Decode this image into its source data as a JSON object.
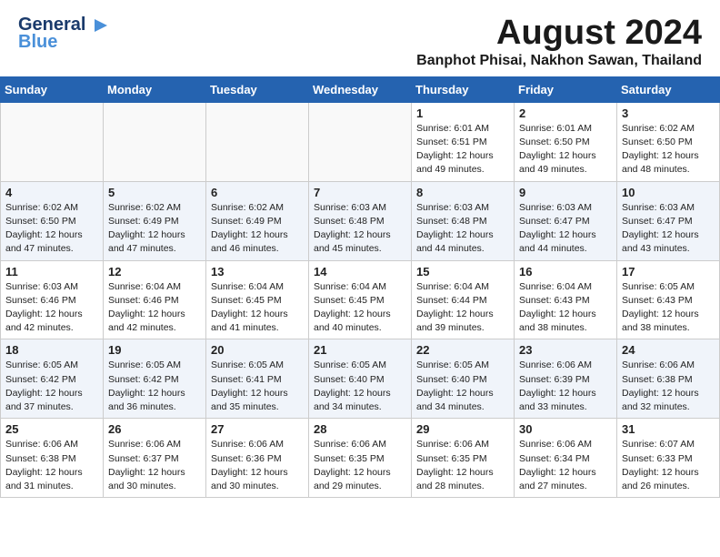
{
  "header": {
    "logo_line1": "General",
    "logo_line2": "Blue",
    "month_title": "August 2024",
    "location": "Banphot Phisai, Nakhon Sawan, Thailand"
  },
  "weekdays": [
    "Sunday",
    "Monday",
    "Tuesday",
    "Wednesday",
    "Thursday",
    "Friday",
    "Saturday"
  ],
  "weeks": [
    [
      {
        "day": "",
        "info": ""
      },
      {
        "day": "",
        "info": ""
      },
      {
        "day": "",
        "info": ""
      },
      {
        "day": "",
        "info": ""
      },
      {
        "day": "1",
        "info": "Sunrise: 6:01 AM\nSunset: 6:51 PM\nDaylight: 12 hours\nand 49 minutes."
      },
      {
        "day": "2",
        "info": "Sunrise: 6:01 AM\nSunset: 6:50 PM\nDaylight: 12 hours\nand 49 minutes."
      },
      {
        "day": "3",
        "info": "Sunrise: 6:02 AM\nSunset: 6:50 PM\nDaylight: 12 hours\nand 48 minutes."
      }
    ],
    [
      {
        "day": "4",
        "info": "Sunrise: 6:02 AM\nSunset: 6:50 PM\nDaylight: 12 hours\nand 47 minutes."
      },
      {
        "day": "5",
        "info": "Sunrise: 6:02 AM\nSunset: 6:49 PM\nDaylight: 12 hours\nand 47 minutes."
      },
      {
        "day": "6",
        "info": "Sunrise: 6:02 AM\nSunset: 6:49 PM\nDaylight: 12 hours\nand 46 minutes."
      },
      {
        "day": "7",
        "info": "Sunrise: 6:03 AM\nSunset: 6:48 PM\nDaylight: 12 hours\nand 45 minutes."
      },
      {
        "day": "8",
        "info": "Sunrise: 6:03 AM\nSunset: 6:48 PM\nDaylight: 12 hours\nand 44 minutes."
      },
      {
        "day": "9",
        "info": "Sunrise: 6:03 AM\nSunset: 6:47 PM\nDaylight: 12 hours\nand 44 minutes."
      },
      {
        "day": "10",
        "info": "Sunrise: 6:03 AM\nSunset: 6:47 PM\nDaylight: 12 hours\nand 43 minutes."
      }
    ],
    [
      {
        "day": "11",
        "info": "Sunrise: 6:03 AM\nSunset: 6:46 PM\nDaylight: 12 hours\nand 42 minutes."
      },
      {
        "day": "12",
        "info": "Sunrise: 6:04 AM\nSunset: 6:46 PM\nDaylight: 12 hours\nand 42 minutes."
      },
      {
        "day": "13",
        "info": "Sunrise: 6:04 AM\nSunset: 6:45 PM\nDaylight: 12 hours\nand 41 minutes."
      },
      {
        "day": "14",
        "info": "Sunrise: 6:04 AM\nSunset: 6:45 PM\nDaylight: 12 hours\nand 40 minutes."
      },
      {
        "day": "15",
        "info": "Sunrise: 6:04 AM\nSunset: 6:44 PM\nDaylight: 12 hours\nand 39 minutes."
      },
      {
        "day": "16",
        "info": "Sunrise: 6:04 AM\nSunset: 6:43 PM\nDaylight: 12 hours\nand 38 minutes."
      },
      {
        "day": "17",
        "info": "Sunrise: 6:05 AM\nSunset: 6:43 PM\nDaylight: 12 hours\nand 38 minutes."
      }
    ],
    [
      {
        "day": "18",
        "info": "Sunrise: 6:05 AM\nSunset: 6:42 PM\nDaylight: 12 hours\nand 37 minutes."
      },
      {
        "day": "19",
        "info": "Sunrise: 6:05 AM\nSunset: 6:42 PM\nDaylight: 12 hours\nand 36 minutes."
      },
      {
        "day": "20",
        "info": "Sunrise: 6:05 AM\nSunset: 6:41 PM\nDaylight: 12 hours\nand 35 minutes."
      },
      {
        "day": "21",
        "info": "Sunrise: 6:05 AM\nSunset: 6:40 PM\nDaylight: 12 hours\nand 34 minutes."
      },
      {
        "day": "22",
        "info": "Sunrise: 6:05 AM\nSunset: 6:40 PM\nDaylight: 12 hours\nand 34 minutes."
      },
      {
        "day": "23",
        "info": "Sunrise: 6:06 AM\nSunset: 6:39 PM\nDaylight: 12 hours\nand 33 minutes."
      },
      {
        "day": "24",
        "info": "Sunrise: 6:06 AM\nSunset: 6:38 PM\nDaylight: 12 hours\nand 32 minutes."
      }
    ],
    [
      {
        "day": "25",
        "info": "Sunrise: 6:06 AM\nSunset: 6:38 PM\nDaylight: 12 hours\nand 31 minutes."
      },
      {
        "day": "26",
        "info": "Sunrise: 6:06 AM\nSunset: 6:37 PM\nDaylight: 12 hours\nand 30 minutes."
      },
      {
        "day": "27",
        "info": "Sunrise: 6:06 AM\nSunset: 6:36 PM\nDaylight: 12 hours\nand 30 minutes."
      },
      {
        "day": "28",
        "info": "Sunrise: 6:06 AM\nSunset: 6:35 PM\nDaylight: 12 hours\nand 29 minutes."
      },
      {
        "day": "29",
        "info": "Sunrise: 6:06 AM\nSunset: 6:35 PM\nDaylight: 12 hours\nand 28 minutes."
      },
      {
        "day": "30",
        "info": "Sunrise: 6:06 AM\nSunset: 6:34 PM\nDaylight: 12 hours\nand 27 minutes."
      },
      {
        "day": "31",
        "info": "Sunrise: 6:07 AM\nSunset: 6:33 PM\nDaylight: 12 hours\nand 26 minutes."
      }
    ]
  ]
}
